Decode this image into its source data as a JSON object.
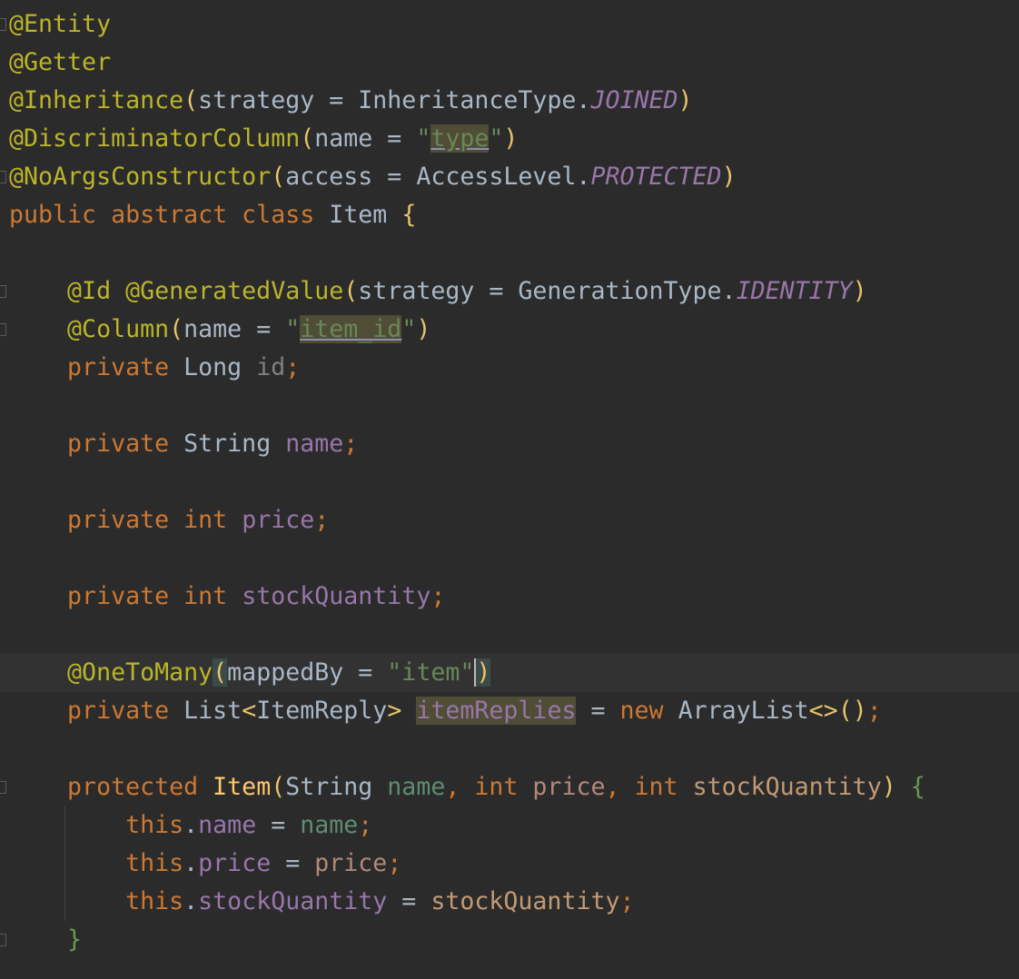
{
  "editor": {
    "language": "java",
    "current_line": 17,
    "lines": [
      [
        [
          "@Entity",
          "ann"
        ]
      ],
      [
        [
          "@Getter",
          "ann"
        ]
      ],
      [
        [
          "@Inheritance",
          "ann"
        ],
        [
          "(",
          "par"
        ],
        [
          "strategy = InheritanceType.",
          "pl"
        ],
        [
          "JOINED",
          "const"
        ],
        [
          ")",
          "par"
        ]
      ],
      [
        [
          "@DiscriminatorColumn",
          "ann"
        ],
        [
          "(",
          "par"
        ],
        [
          "name = ",
          "pl"
        ],
        [
          "\"",
          "str"
        ],
        [
          "type",
          "str hlu"
        ],
        [
          "\"",
          "str"
        ],
        [
          ")",
          "par"
        ]
      ],
      [
        [
          "@NoArgsConstructor",
          "ann"
        ],
        [
          "(",
          "par"
        ],
        [
          "access = AccessLevel.",
          "pl"
        ],
        [
          "PROTECTED",
          "const"
        ],
        [
          ")",
          "par"
        ]
      ],
      [
        [
          "public abstract class ",
          "kw"
        ],
        [
          "Item ",
          "pl"
        ],
        [
          "{",
          "par"
        ]
      ],
      [],
      [
        [
          "    ",
          "pl"
        ],
        [
          "@Id @GeneratedValue",
          "ann"
        ],
        [
          "(",
          "par"
        ],
        [
          "strategy = GenerationType.",
          "pl"
        ],
        [
          "IDENTITY",
          "const"
        ],
        [
          ")",
          "par"
        ]
      ],
      [
        [
          "    ",
          "pl"
        ],
        [
          "@Column",
          "ann"
        ],
        [
          "(",
          "par"
        ],
        [
          "name = ",
          "pl"
        ],
        [
          "\"",
          "str"
        ],
        [
          "item_id",
          "str hlu"
        ],
        [
          "\"",
          "str"
        ],
        [
          ")",
          "par"
        ]
      ],
      [
        [
          "    ",
          "pl"
        ],
        [
          "private ",
          "kw"
        ],
        [
          "Long ",
          "pl"
        ],
        [
          "id",
          "unused"
        ],
        [
          ";",
          "kw"
        ]
      ],
      [],
      [
        [
          "    ",
          "pl"
        ],
        [
          "private ",
          "kw"
        ],
        [
          "String ",
          "pl"
        ],
        [
          "name",
          "fld"
        ],
        [
          ";",
          "kw"
        ]
      ],
      [],
      [
        [
          "    ",
          "pl"
        ],
        [
          "private int ",
          "kw"
        ],
        [
          "price",
          "fld"
        ],
        [
          ";",
          "kw"
        ]
      ],
      [],
      [
        [
          "    ",
          "pl"
        ],
        [
          "private int ",
          "kw"
        ],
        [
          "stockQuantity",
          "fld"
        ],
        [
          ";",
          "kw"
        ]
      ],
      [],
      [
        [
          "    ",
          "pl"
        ],
        [
          "@OneToMany",
          "ann"
        ],
        [
          "(",
          "par brm"
        ],
        [
          "mappedBy = ",
          "pl"
        ],
        [
          "\"item\"",
          "str"
        ],
        [
          ")",
          "par brm caret"
        ]
      ],
      [
        [
          "    ",
          "pl"
        ],
        [
          "private ",
          "kw"
        ],
        [
          "List",
          "pl"
        ],
        [
          "<",
          "par"
        ],
        [
          "ItemReply",
          "pl"
        ],
        [
          "> ",
          "par"
        ],
        [
          "itemReplies",
          "fld hl"
        ],
        [
          " = ",
          "pl"
        ],
        [
          "new ",
          "kw"
        ],
        [
          "ArrayList",
          "pl"
        ],
        [
          "<>",
          "par"
        ],
        [
          "()",
          "par"
        ],
        [
          ";",
          "kw"
        ]
      ],
      [],
      [
        [
          "    ",
          "pl"
        ],
        [
          "protected ",
          "kw"
        ],
        [
          "Item",
          "mth"
        ],
        [
          "(",
          "par"
        ],
        [
          "String ",
          "pl"
        ],
        [
          "name",
          "pn"
        ],
        [
          ", ",
          "kw"
        ],
        [
          "int ",
          "kw"
        ],
        [
          "price",
          "pp"
        ],
        [
          ", ",
          "kw"
        ],
        [
          "int ",
          "kw"
        ],
        [
          "stockQuantity",
          "ps"
        ],
        [
          ")",
          "par"
        ],
        [
          " ",
          "pl"
        ],
        [
          "{",
          "grn"
        ]
      ],
      [
        [
          "        ",
          "pl"
        ],
        [
          "this",
          "kw"
        ],
        [
          ".",
          "pl"
        ],
        [
          "name",
          "fld"
        ],
        [
          " = ",
          "pl"
        ],
        [
          "name",
          "pn"
        ],
        [
          ";",
          "kw"
        ]
      ],
      [
        [
          "        ",
          "pl"
        ],
        [
          "this",
          "kw"
        ],
        [
          ".",
          "pl"
        ],
        [
          "price",
          "fld"
        ],
        [
          " = ",
          "pl"
        ],
        [
          "price",
          "pp"
        ],
        [
          ";",
          "kw"
        ]
      ],
      [
        [
          "        ",
          "pl"
        ],
        [
          "this",
          "kw"
        ],
        [
          ".",
          "pl"
        ],
        [
          "stockQuantity",
          "fld"
        ],
        [
          " = ",
          "pl"
        ],
        [
          "stockQuantity",
          "ps"
        ],
        [
          ";",
          "kw"
        ]
      ],
      [
        [
          "    ",
          "pl"
        ],
        [
          "}",
          "grn"
        ]
      ]
    ]
  }
}
